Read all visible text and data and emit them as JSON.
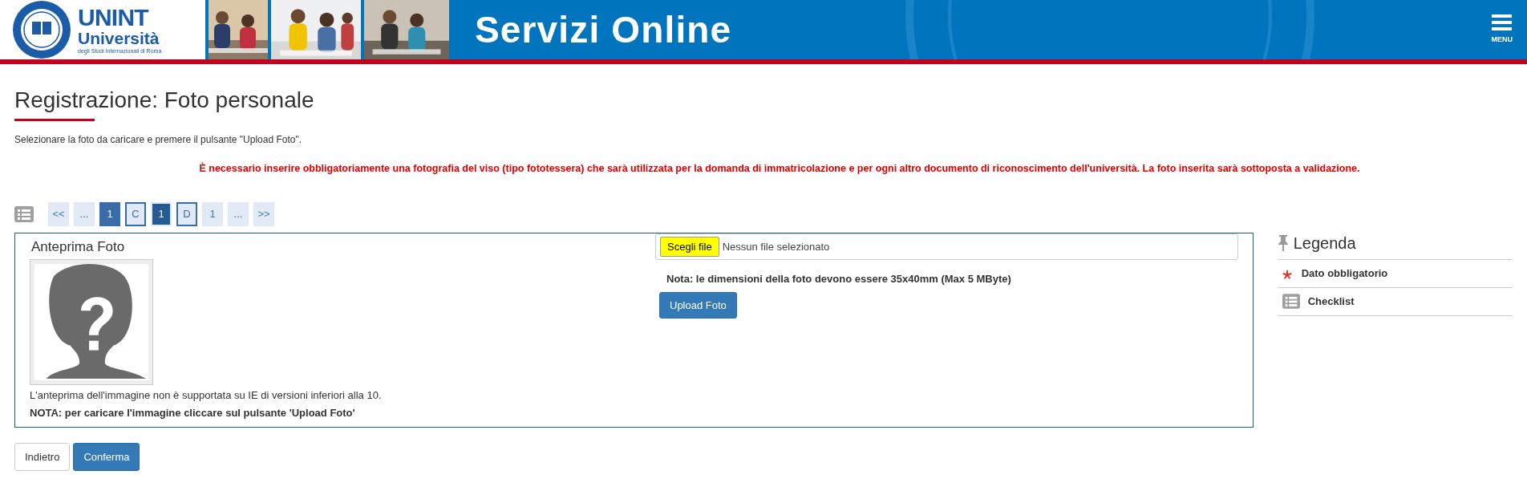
{
  "header": {
    "logo_mark": "UNINT",
    "logo_name": "Università",
    "logo_subtitle": "degli Studi Internazionali di Roma",
    "banner_title": "Servizi Online",
    "menu_label": "MENU"
  },
  "page": {
    "title": "Registrazione: Foto personale",
    "instruction": "Selezionare la foto da caricare e premere il pulsante \"Upload Foto\".",
    "warning": "È necessario inserire obbligatoriamente una fotografia del viso (tipo fototessera) che sarà utilizzata per la domanda di immatricolazione e per ogni altro documento di riconoscimento dell'università. La foto inserita sarà sottoposta a validazione."
  },
  "steps": [
    {
      "label": "<<",
      "kind": "nav",
      "selected": false
    },
    {
      "label": "...",
      "kind": "nav",
      "selected": false
    },
    {
      "label": "1",
      "kind": "done",
      "selected": false
    },
    {
      "label": "C",
      "kind": "section",
      "selected": false
    },
    {
      "label": "1",
      "kind": "done",
      "selected": true
    },
    {
      "label": "D",
      "kind": "section",
      "selected": false
    },
    {
      "label": "1",
      "kind": "nav",
      "selected": false
    },
    {
      "label": "...",
      "kind": "nav",
      "selected": false
    },
    {
      "label": ">>",
      "kind": "nav",
      "selected": false
    }
  ],
  "preview": {
    "title": "Anteprima Foto",
    "note": "L'anteprima dell'immagine non è supportata su IE di versioni inferiori alla 10.",
    "bold_note": "NOTA: per caricare l'immagine cliccare sul pulsante 'Upload Foto'"
  },
  "upload": {
    "choose_button": "Scegli file",
    "file_status": "Nessun file selezionato",
    "size_note": "Nota: le dimensioni della foto devono essere 35x40mm (Max 5 MByte)",
    "upload_button": "Upload Foto"
  },
  "legend": {
    "title": "Legenda",
    "items": [
      {
        "label": "Dato obbligatorio",
        "kind": "required"
      },
      {
        "label": "Checklist",
        "kind": "checklist"
      }
    ]
  },
  "buttons": [
    {
      "label": "Indietro",
      "kind": "default"
    },
    {
      "label": "Conferma",
      "kind": "primary"
    }
  ]
}
